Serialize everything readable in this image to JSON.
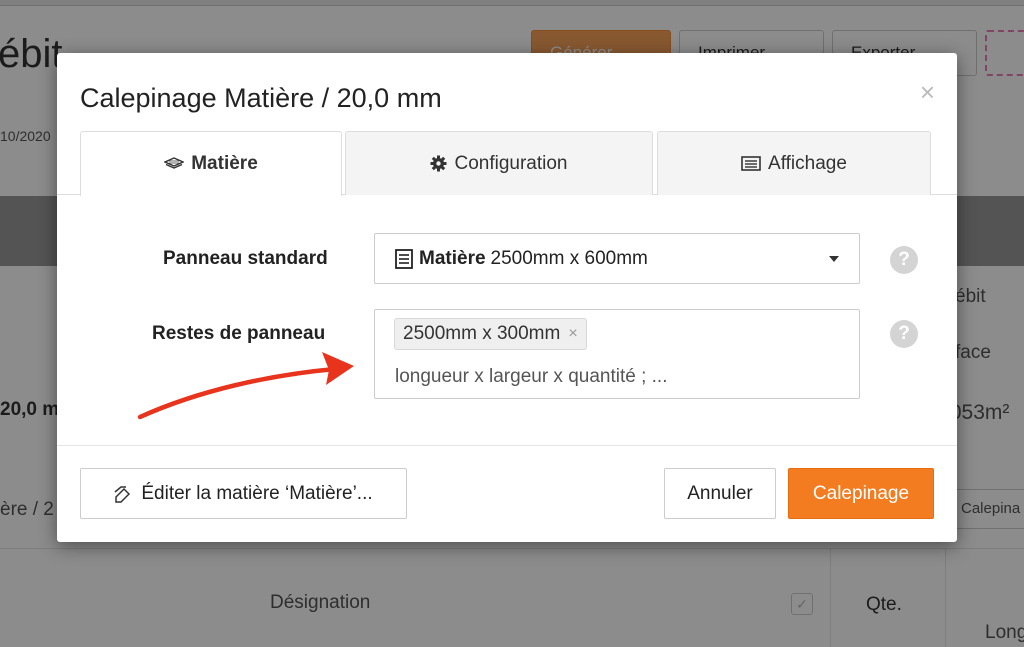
{
  "background": {
    "title": "ébit",
    "buttons": [
      "Générer",
      "Imprimer",
      "Exporter"
    ],
    "date": "10/2020",
    "right_col": [
      "ébit",
      "face",
      ",053m²"
    ],
    "left_values": [
      "20,0 m",
      "ère / 2"
    ],
    "designation": "Désignation",
    "qte": "Qte.",
    "long": "Long",
    "calepinage_small": "Calepina"
  },
  "modal": {
    "title": "Calepinage Matière / 20,0 mm",
    "close": "×",
    "tabs": [
      {
        "label": "Matière",
        "icon": "layers-icon"
      },
      {
        "label": "Configuration",
        "icon": "gear-icon"
      },
      {
        "label": "Affichage",
        "icon": "list-icon"
      }
    ],
    "panneau_standard": {
      "label": "Panneau standard",
      "value_bold": "Matière",
      "value_rest": "2500mm x 600mm",
      "icon": "list-icon"
    },
    "restes": {
      "label": "Restes de panneau",
      "tags": [
        "2500mm x 300mm"
      ],
      "placeholder": "longueur x largeur x quantité ; ..."
    },
    "help": "?",
    "footer": {
      "edit_button": "Éditer la matière ‘Matière’...",
      "cancel_button": "Annuler",
      "submit_button": "Calepinage"
    }
  },
  "colors": {
    "primary": "#f37c21",
    "arrow": "#e8331d"
  }
}
